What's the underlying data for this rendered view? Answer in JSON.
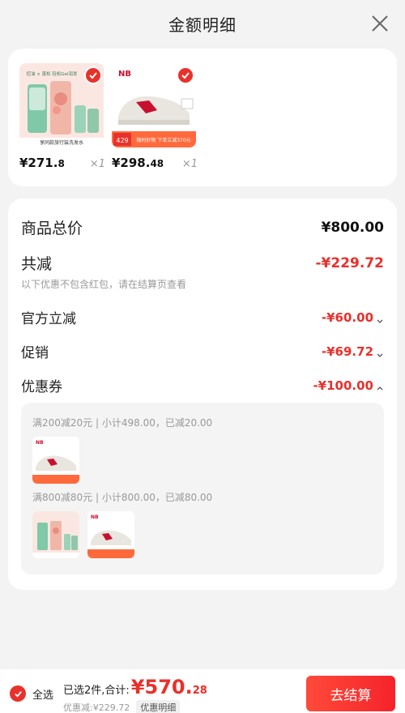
{
  "header": {
    "title": "金额明细"
  },
  "products": [
    {
      "name": "享同款旅行装洗发水",
      "price_int": "¥271.",
      "price_dec": "8",
      "qty": "×1",
      "thumb_text": "控油 × 蓬松 轻松Gel润发",
      "thumb_caption": "享同款旅行装洗发水"
    },
    {
      "name": "New Balance sneaker",
      "price_int": "¥298.",
      "price_dec": "48",
      "qty": "×1",
      "promo_price": "429",
      "promo_tag": "限时好物 下单立减370元"
    }
  ],
  "summary": {
    "goods_total_label": "商品总价",
    "goods_total_value": "¥800.00",
    "reduce_label": "共减",
    "reduce_value": "-¥229.72",
    "note": "以下优惠不包含红包，请在结算页查看",
    "official_label": "官方立减",
    "official_value": "-¥60.00",
    "promo_label": "促销",
    "promo_value": "-¥69.72",
    "coupon_label": "优惠券",
    "coupon_value": "-¥100.00",
    "coupon_rules": [
      "满200减20元 | 小计498.00，已减20.00",
      "满800减80元 | 小计800.00，已减80.00"
    ]
  },
  "bottom": {
    "select_all": "全选",
    "selected_total_label": "已选2件,合计:",
    "total_int": "¥570.",
    "total_dec": "28",
    "discount_text": "优惠减:¥229.72",
    "detail_label": "优惠明细",
    "checkout_label": "去结算"
  },
  "colors": {
    "accent": "#e8312b",
    "brand_nb": "#c8102e"
  }
}
